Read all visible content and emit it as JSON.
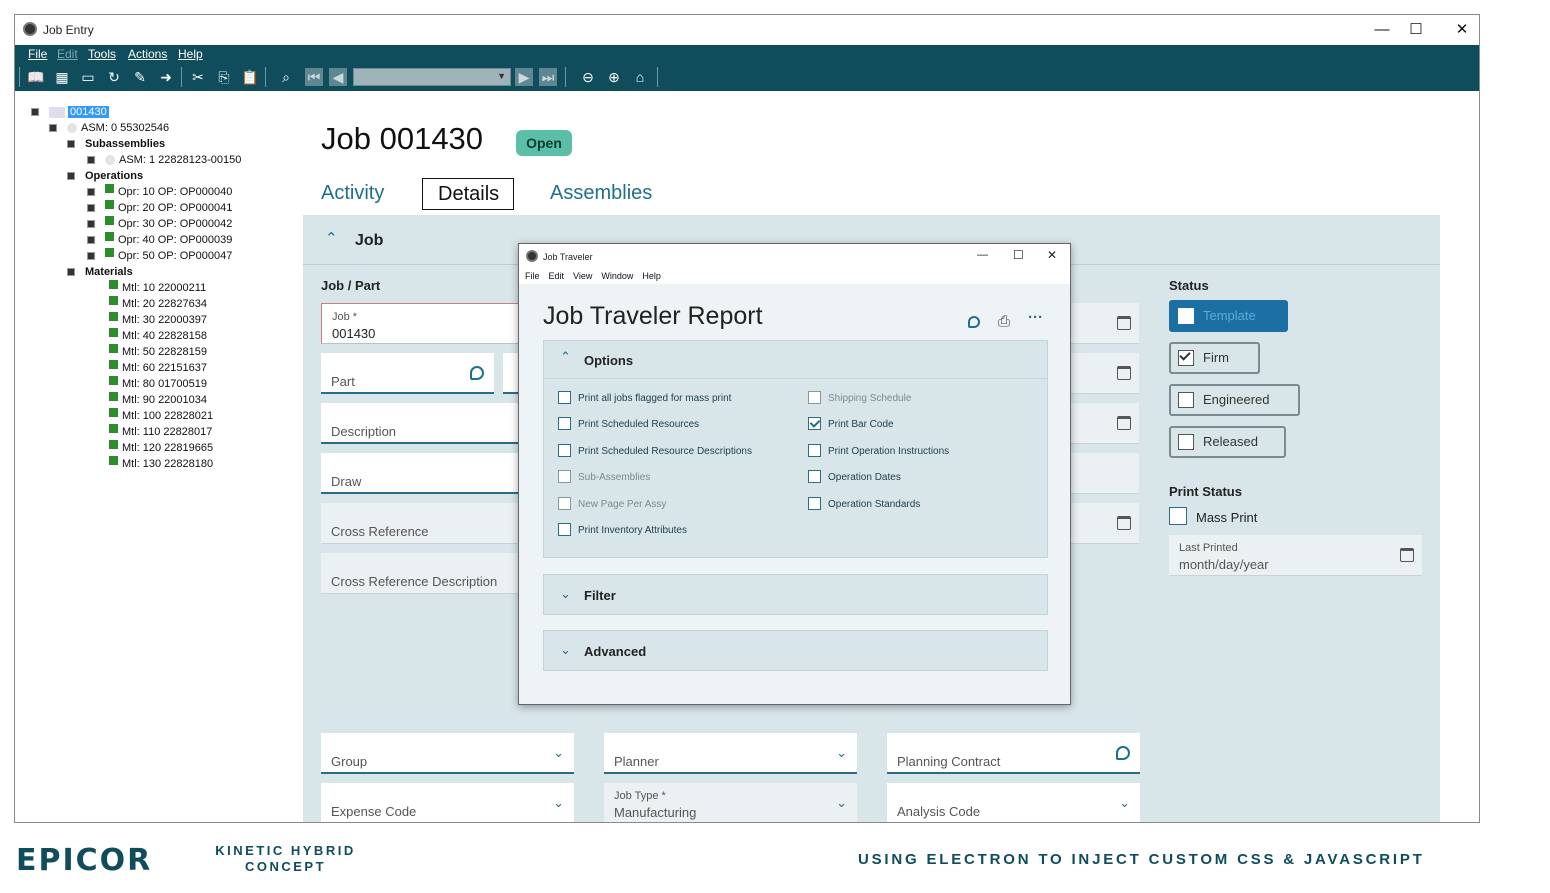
{
  "window": {
    "title": "Job Entry",
    "minimize": "—",
    "maximize": "☐",
    "close": "✕"
  },
  "menu": [
    "File",
    "Edit",
    "Tools",
    "Actions",
    "Help"
  ],
  "toolbar": {
    "combo_value": ""
  },
  "tree": {
    "root": "001430",
    "asm0": "ASM: 0 55302546",
    "subassemblies_label": "Subassemblies",
    "asm1": "ASM: 1 22828123-00150",
    "operations_label": "Operations",
    "operations": [
      "Opr: 10 OP: OP000040",
      "Opr: 20 OP: OP000041",
      "Opr: 30 OP: OP000042",
      "Opr: 40 OP: OP000039",
      "Opr: 50 OP: OP000047"
    ],
    "materials_label": "Materials",
    "materials": [
      "Mtl: 10 22000211",
      "Mtl: 20 22827634",
      "Mtl: 30 22000397",
      "Mtl: 40 22828158",
      "Mtl: 50 22828159",
      "Mtl: 60 22151637",
      "Mtl: 80 01700519",
      "Mtl: 90 22001034",
      "Mtl: 100 22828021",
      "Mtl: 110 22828017",
      "Mtl: 120 22819665",
      "Mtl: 130 22828180"
    ]
  },
  "job": {
    "title": "Job 001430",
    "status_badge": "Open"
  },
  "tabs": [
    "Activity",
    "Details",
    "Assemblies"
  ],
  "panel": {
    "section": "Job",
    "job_part_label": "Job / Part",
    "job_field_label": "Job *",
    "job_field_value": "001430",
    "part_label": "Part",
    "description_label": "Description",
    "draw_label": "Draw",
    "cross_ref_label": "Cross Reference",
    "cross_ref_desc_label": "Cross Reference Description",
    "group_label": "Group",
    "planner_label": "Planner",
    "planning_contract_label": "Planning Contract",
    "expense_code_label": "Expense Code",
    "job_type_label": "Job Type *",
    "job_type_value": "Manufacturing",
    "analysis_code_label": "Analysis Code"
  },
  "status": {
    "label": "Status",
    "template": "Template",
    "firm": "Firm",
    "engineered": "Engineered",
    "released": "Released",
    "print_status_label": "Print Status",
    "mass_print": "Mass Print",
    "last_printed_label": "Last Printed",
    "last_printed_value": "month/day/year"
  },
  "modal": {
    "title": "Job Traveler",
    "menu": [
      "File",
      "Edit",
      "View",
      "Window",
      "Help"
    ],
    "report_title": "Job Traveler Report",
    "options_label": "Options",
    "options_left": [
      {
        "label": "Print all jobs flagged for mass print",
        "checked": false,
        "disabled": false
      },
      {
        "label": "Print Scheduled Resources",
        "checked": false,
        "disabled": false
      },
      {
        "label": "Print Scheduled Resource Descriptions",
        "checked": false,
        "disabled": false
      },
      {
        "label": "Sub-Assemblies",
        "checked": false,
        "disabled": true
      },
      {
        "label": "New Page Per Assy",
        "checked": false,
        "disabled": true
      },
      {
        "label": "Print Inventory Attributes",
        "checked": false,
        "disabled": false
      }
    ],
    "options_right": [
      {
        "label": "Shipping Schedule",
        "checked": false,
        "disabled": true
      },
      {
        "label": "Print Bar Code",
        "checked": true,
        "disabled": false
      },
      {
        "label": "Print Operation Instructions",
        "checked": false,
        "disabled": false
      },
      {
        "label": "Operation Dates",
        "checked": false,
        "disabled": false
      },
      {
        "label": "Operation Standards",
        "checked": false,
        "disabled": false
      }
    ],
    "filter_label": "Filter",
    "advanced_label": "Advanced",
    "more": "···"
  },
  "footer": {
    "brand": "EPICOR",
    "product_line1": "KINETIC HYBRID",
    "product_line2": "CONCEPT",
    "tagline": "USING ELECTRON TO INJECT CUSTOM CSS & JAVASCRIPT"
  },
  "colors": {
    "brand": "#0f4c5c",
    "accent": "#1f6f8b",
    "panel": "#d8e6ea",
    "badge": "#5bbfa8"
  }
}
